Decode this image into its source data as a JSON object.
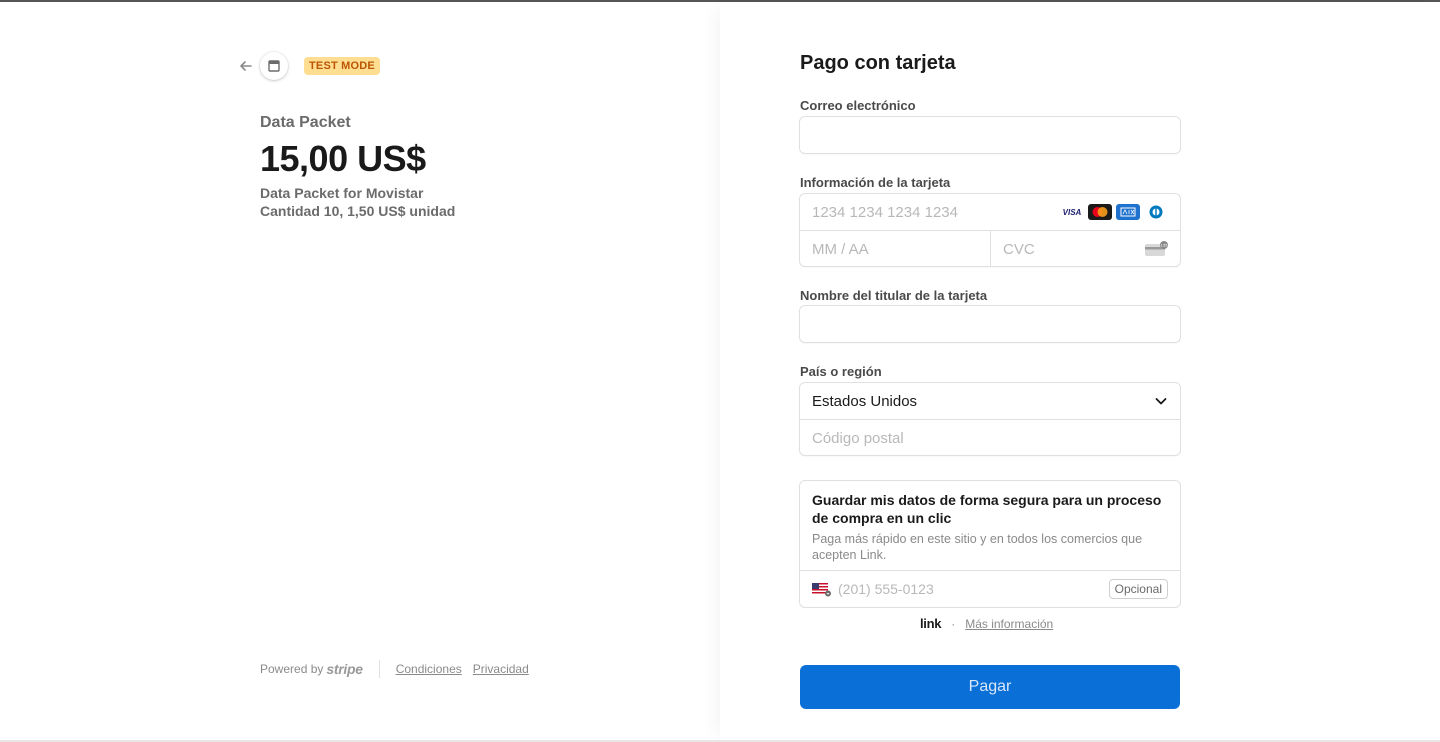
{
  "header": {
    "back_icon": "arrow-left-icon",
    "store_icon": "store-icon",
    "test_badge": "TEST MODE"
  },
  "product": {
    "name": "Data Packet",
    "price": "15,00 US$",
    "description": "Data Packet for Movistar",
    "quantity_line": "Cantidad 10, 1,50 US$ unidad"
  },
  "footer": {
    "powered_by": "Powered by",
    "stripe": "stripe",
    "terms": "Condiciones",
    "privacy": "Privacidad"
  },
  "form": {
    "title": "Pago con tarjeta",
    "email_label": "Correo electrónico",
    "email_value": "",
    "card_label": "Información de la tarjeta",
    "card_number_placeholder": "1234 1234 1234 1234",
    "expiry_placeholder": "MM / AA",
    "cvc_placeholder": "CVC",
    "card_brands": [
      "VISA",
      "mastercard",
      "amex",
      "diners"
    ],
    "holder_label": "Nombre del titular de la tarjeta",
    "holder_value": "",
    "country_label": "País o región",
    "country_value": "Estados Unidos",
    "postal_placeholder": "Código postal"
  },
  "link": {
    "title": "Guardar mis datos de forma segura para un proceso de compra en un clic",
    "subtitle": "Paga más rápido en este sitio y en todos los comercios que acepten Link.",
    "phone_placeholder": "(201) 555-0123",
    "optional": "Opcional",
    "logo": "link",
    "separator": "·",
    "more_info": "Más información"
  },
  "pay_button": "Pagar",
  "colors": {
    "accent": "#0a6fd6",
    "badge_bg": "#ffde92",
    "badge_text": "#bb5504"
  }
}
